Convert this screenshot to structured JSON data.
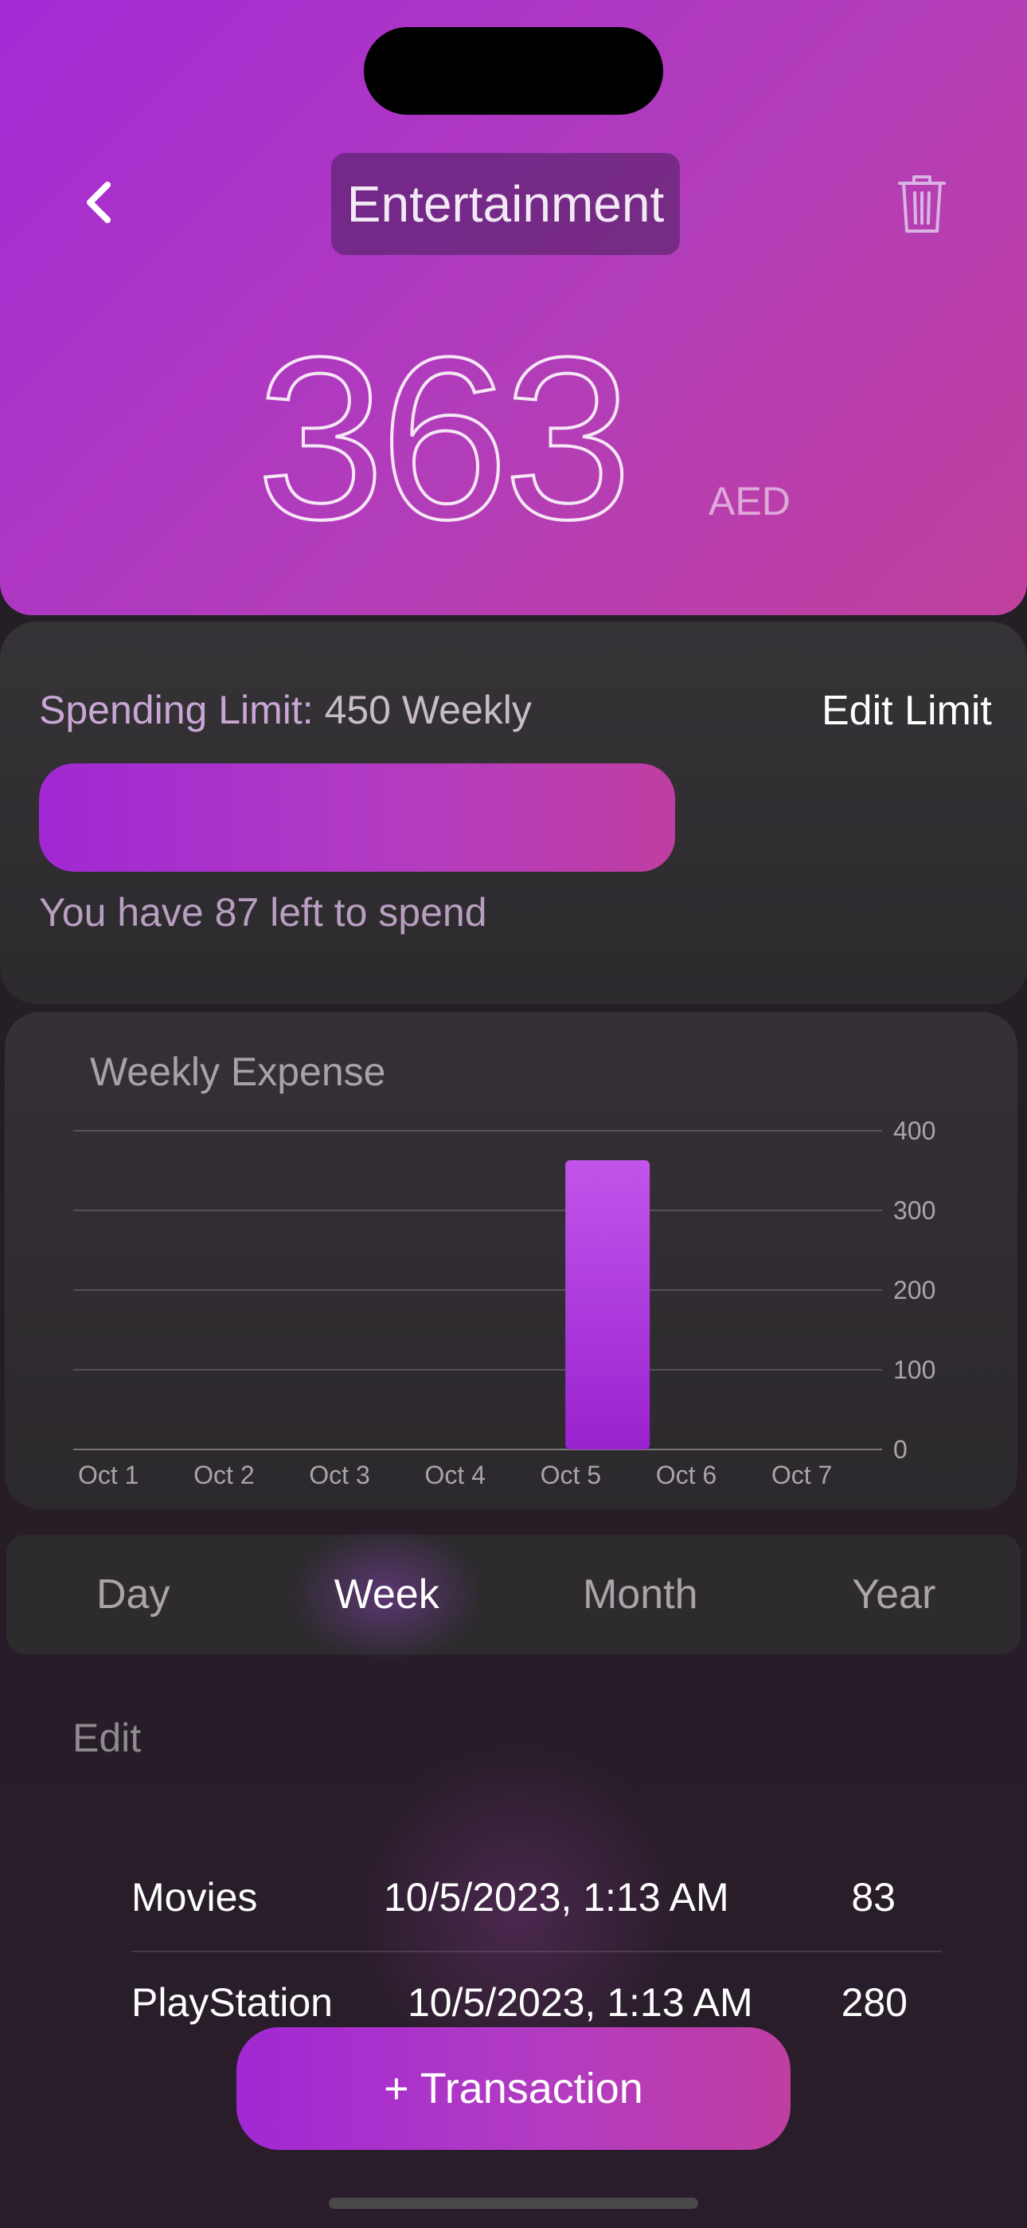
{
  "header": {
    "title": "Entertainment",
    "amount": "363",
    "currency": "AED",
    "back_icon": "chevron-left-icon",
    "trash_icon": "trash-icon"
  },
  "limit": {
    "label_prefix": "Spending Limit:",
    "label_value": "450 Weekly",
    "edit_label": "Edit Limit",
    "progress_fraction": 0.807,
    "remaining_text": "You have 87 left to spend"
  },
  "chart_data": {
    "type": "bar",
    "title": "Weekly Expense",
    "categories": [
      "Oct 1",
      "Oct 2",
      "Oct 3",
      "Oct 4",
      "Oct 5",
      "Oct 6",
      "Oct 7"
    ],
    "values": [
      0,
      0,
      0,
      0,
      363,
      0,
      0
    ],
    "ylim": [
      0,
      400
    ],
    "yticks": [
      "400",
      "300",
      "200",
      "100",
      "0"
    ],
    "xlabel": "",
    "ylabel": "",
    "grid": true,
    "bar_color": "#b04ae0"
  },
  "period_tabs": {
    "items": [
      "Day",
      "Week",
      "Month",
      "Year"
    ],
    "selected": "Week"
  },
  "transactions": {
    "edit_label": "Edit",
    "rows": [
      {
        "name": "Movies",
        "date": "10/5/2023, 1:13 AM",
        "amount": "83"
      },
      {
        "name": "PlayStation",
        "date": "10/5/2023, 1:13 AM",
        "amount": "280"
      }
    ]
  },
  "add_button": {
    "label": "+ Transaction"
  },
  "colors": {
    "accent": "#a52ad6",
    "accent_end": "#c0409e",
    "background": "#232124"
  }
}
